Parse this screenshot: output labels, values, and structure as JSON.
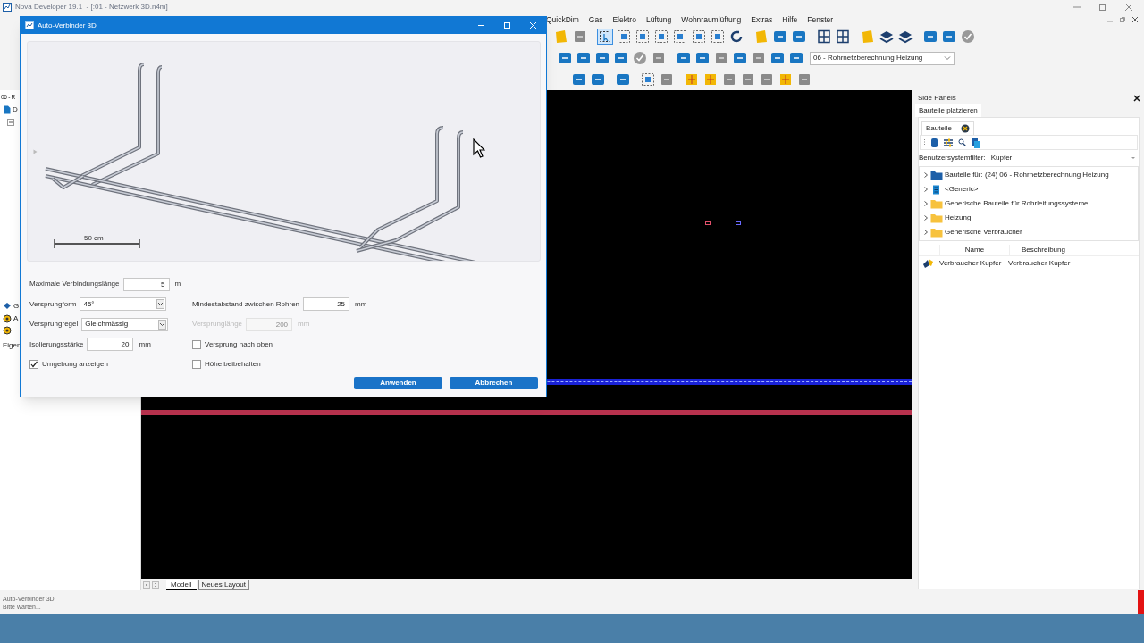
{
  "app_window": {
    "title": "Nova Developer 19.1  - [:01 - Netzwerk 3D.n4m]",
    "menu": [
      "QuickDim",
      "Gas",
      "Elektro",
      "Lüftung",
      "Wohnraumlüftung",
      "Extras",
      "Hilfe",
      "Fenster"
    ],
    "layer_select": {
      "value": "06 - Rohrnetzberechnung Heizung"
    }
  },
  "left_panel": {
    "header": "06 - R",
    "tree": [
      "D"
    ],
    "list": [
      "G",
      "A"
    ],
    "footer": "Eigen"
  },
  "canvas": {
    "layout_tabs": [
      {
        "label": "Modell",
        "selected": true
      },
      {
        "label": "Neues Layout",
        "selected": false
      }
    ]
  },
  "side_panel": {
    "title": "Side Panels",
    "tab": "Bauteile platzieren",
    "subtab": "Bauteile",
    "filter": {
      "label": "Benutzersystemfilter:",
      "value": "Kupfer"
    },
    "tree": [
      {
        "kind": "project",
        "label": "Bauteile für: (24) 06 - Rohrnetzberechnung Heizung",
        "expanded": false
      },
      {
        "kind": "list",
        "label": "<Generic>",
        "expanded": false
      },
      {
        "kind": "folder",
        "label": "Generische Bauteile für Rohrleitungssysteme",
        "expanded": false
      },
      {
        "kind": "folder",
        "label": "Heizung",
        "expanded": false
      },
      {
        "kind": "folder",
        "label": "Generische Verbraucher",
        "expanded": false
      }
    ],
    "table": {
      "columns": [
        "Name",
        "Beschreibung"
      ],
      "rows": [
        [
          "Verbraucher Kupfer",
          "Verbraucher Kupfer"
        ]
      ]
    }
  },
  "status_bar": {
    "lines": [
      "Auto-Verbinder 3D",
      "Bitte warten..."
    ]
  },
  "dialog": {
    "title": "Auto-Verbinder 3D",
    "preview": {
      "scale_label": "50 cm"
    },
    "left_fields": [
      {
        "kind": "number",
        "label": "Maximale Verbindungslänge",
        "value": "5",
        "unit": "m",
        "disabled": false
      },
      {
        "kind": "select",
        "label": "Versprungform",
        "value": "45°",
        "disabled": false
      },
      {
        "kind": "select",
        "label": "Versprungregel",
        "value": "Gleichmässig",
        "disabled": false
      },
      {
        "kind": "number",
        "label": "Isolierungsstärke",
        "value": "20",
        "unit": "mm",
        "disabled": false
      },
      {
        "kind": "checkbox",
        "label": "Umgebung anzeigen",
        "checked": true,
        "disabled": false
      }
    ],
    "right_fields": [
      {
        "kind": "number",
        "label": "Mindestabstand zwischen Rohren",
        "value": "25",
        "unit": "mm",
        "disabled": false
      },
      {
        "kind": "number",
        "label": "Versprunglänge",
        "value": "200",
        "unit": "mm",
        "disabled": true
      },
      {
        "kind": "checkbox",
        "label": "Versprung nach oben",
        "checked": false,
        "disabled": false
      },
      {
        "kind": "checkbox",
        "label": "Höhe beibehalten",
        "checked": false,
        "disabled": false
      }
    ],
    "buttons": [
      "Anwenden",
      "Abbrechen"
    ]
  }
}
